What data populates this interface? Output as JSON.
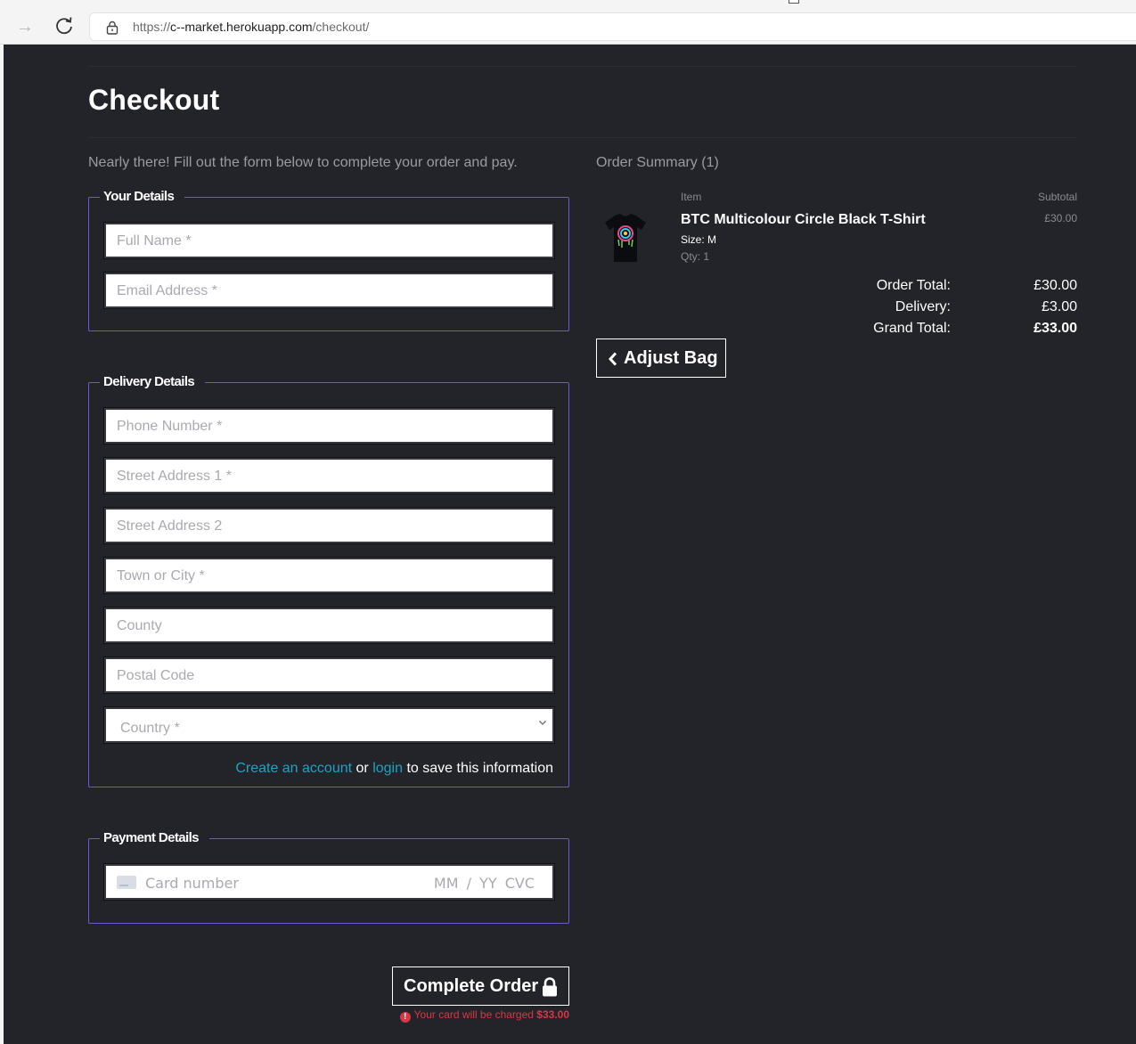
{
  "browser": {
    "url_prefix": "https://",
    "url_host": "c--market.herokuapp.com",
    "url_path": "/checkout/"
  },
  "page": {
    "title": "Checkout",
    "intro": "Nearly there! Fill out the form below to complete your order and pay."
  },
  "your_details": {
    "legend": "Your Details",
    "full_name_placeholder": "Full Name *",
    "email_placeholder": "Email Address *"
  },
  "delivery_details": {
    "legend": "Delivery Details",
    "phone_placeholder": "Phone Number *",
    "street1_placeholder": "Street Address 1 *",
    "street2_placeholder": "Street Address 2",
    "town_placeholder": "Town or City *",
    "county_placeholder": "County",
    "postcode_placeholder": "Postal Code",
    "country_placeholder": "Country *",
    "create_account_link": "Create an account",
    "or_text": "or",
    "login_link": "login",
    "save_text": "to save this information"
  },
  "payment_details": {
    "legend": "Payment Details",
    "card_placeholder": "Card number",
    "expiry_cvc_placeholder": "MM / YY  CVC"
  },
  "actions": {
    "complete_order_label": "Complete Order",
    "charge_notice": "Your card will be charged",
    "charge_amount": "$33.00"
  },
  "order_summary": {
    "title": "Order Summary (1)",
    "item_header": "Item",
    "subtotal_header": "Subtotal",
    "items": [
      {
        "name": "BTC Multicolour Circle Black T-Shirt",
        "size": "Size: M",
        "qty": "Qty: 1",
        "subtotal": "£30.00"
      }
    ],
    "order_total_label": "Order Total:",
    "order_total": "£30.00",
    "delivery_label": "Delivery:",
    "delivery": "£3.00",
    "grand_total_label": "Grand Total:",
    "grand_total": "£33.00",
    "adjust_bag_label": "Adjust Bag"
  },
  "colors": {
    "page_bg": "#232429",
    "fieldset_border": "#6a5acd",
    "link": "#1fa2c4",
    "error": "#dc3545"
  }
}
